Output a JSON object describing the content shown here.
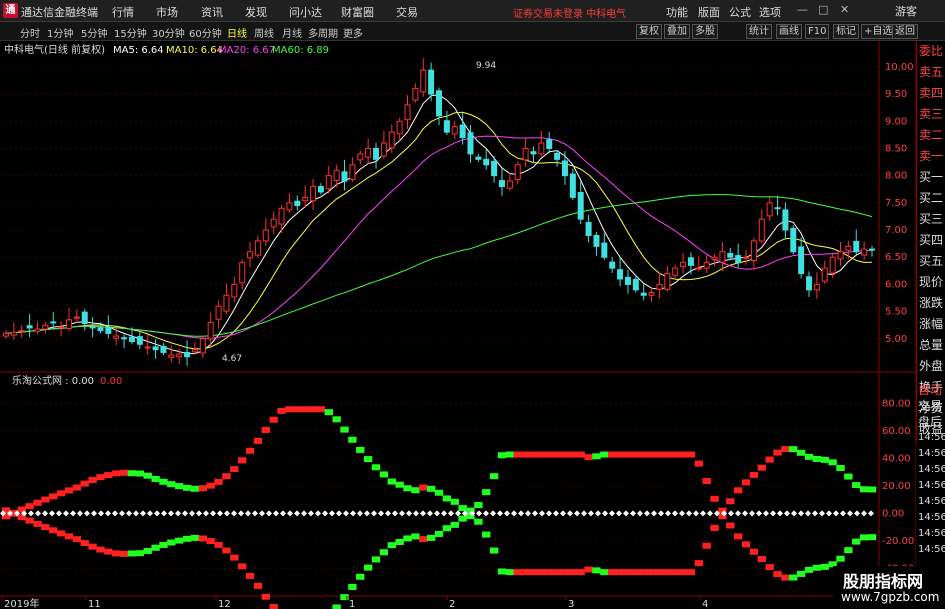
{
  "app": {
    "title": "通达信金融终端",
    "logo_char": "通"
  },
  "menu": [
    "行情",
    "市场",
    "资讯",
    "发现",
    "问小达",
    "财富圈",
    "交易"
  ],
  "login_status": "证券交易未登录  中科电气",
  "tools": [
    "功能",
    "版面",
    "公式",
    "选项"
  ],
  "window_controls": {
    "minimize": "—",
    "maximize": "□",
    "close": "✕",
    "guest": "游客"
  },
  "periods": [
    "分时",
    "1分钟",
    "5分钟",
    "15分钟",
    "30分钟",
    "60分钟",
    "日线",
    "周线",
    "月线",
    "多周期",
    "更多"
  ],
  "active_period": "日线",
  "toolbar_buttons": [
    "复权",
    "叠加",
    "多股",
    "统计",
    "画线",
    "F10",
    "标记",
    "+自选",
    "返回"
  ],
  "stock": {
    "name_line": "中科电气(日线 前复权)",
    "ma": [
      {
        "label": "MA5: 6.64",
        "color": "#ffffff"
      },
      {
        "label": "MA10: 6.64",
        "color": "#ffff40"
      },
      {
        "label": "MA20: 6.67",
        "color": "#ff40ff"
      },
      {
        "label": "MA60: 6.89",
        "color": "#40ff40"
      }
    ],
    "high_label": "9.94",
    "low_label": "4.67"
  },
  "indicator": {
    "name": "乐淘公式网 : 0.00",
    "value": "0.00"
  },
  "price_axis": [
    "10.00",
    "9.50",
    "9.00",
    "8.50",
    "8.00",
    "7.50",
    "7.00",
    "6.50",
    "6.00",
    "5.50",
    "5.00"
  ],
  "indicator_axis": [
    "80.00",
    "60.00",
    "40.00",
    "20.00",
    "0.00",
    "-20.00",
    "-40.00"
  ],
  "date_axis": [
    "2019年",
    "11",
    "12",
    "1",
    "2",
    "3",
    "4"
  ],
  "quote_panel": [
    "委比",
    "卖五",
    "卖四",
    "卖三",
    "卖二",
    "卖一",
    "买一",
    "买二",
    "买三",
    "买四",
    "买五",
    "现价",
    "涨跌",
    "涨幅",
    "总量",
    "外盘",
    "换手",
    "净资",
    "收益"
  ],
  "side_panel": [
    "自动",
    "交易",
    "盘后",
    "14:56",
    "14:56",
    "14:56",
    "14:56",
    "14:56",
    "14:56",
    "14:56",
    "14:56"
  ],
  "colors": {
    "up": "#ff3030",
    "down": "#40e0e0",
    "ma5": "#ffffff",
    "ma10": "#ffff40",
    "ma20": "#ff40ff",
    "ma60": "#40ff40",
    "osc_up": "#ff2020",
    "osc_down": "#20ff20",
    "border": "#8b0000"
  },
  "watermark": {
    "title": "股朋指标网",
    "url": "www.7gpzb.com"
  },
  "chart_data": {
    "type": "candlestick",
    "price_range": [
      4.5,
      10.2
    ],
    "indicator_range": [
      -58,
      92
    ],
    "close_series": [
      5.1,
      5.12,
      5.15,
      5.2,
      5.18,
      5.25,
      5.3,
      5.22,
      5.35,
      5.4,
      5.28,
      5.2,
      5.15,
      5.1,
      5.05,
      5.0,
      4.95,
      4.9,
      4.85,
      4.8,
      4.75,
      4.7,
      4.72,
      4.67,
      4.8,
      5.0,
      5.3,
      5.6,
      5.8,
      6.0,
      6.4,
      6.6,
      6.8,
      7.0,
      7.2,
      7.4,
      7.5,
      7.45,
      7.6,
      7.8,
      7.7,
      8.0,
      8.1,
      7.9,
      8.2,
      8.4,
      8.5,
      8.3,
      8.6,
      8.8,
      9.0,
      9.3,
      9.6,
      9.94,
      9.5,
      9.1,
      8.8,
      8.9,
      8.7,
      8.4,
      8.3,
      8.2,
      8.0,
      7.8,
      7.9,
      8.2,
      8.5,
      8.4,
      8.6,
      8.5,
      8.3,
      8.0,
      7.6,
      7.2,
      6.9,
      6.7,
      6.5,
      6.3,
      6.1,
      6.0,
      5.9,
      5.8,
      5.85,
      6.0,
      6.2,
      6.3,
      6.4,
      6.35,
      6.3,
      6.4,
      6.5,
      6.6,
      6.5,
      6.4,
      6.5,
      6.8,
      7.2,
      7.5,
      7.4,
      7.0,
      6.6,
      6.2,
      5.9,
      6.0,
      6.3,
      6.5,
      6.6,
      6.7,
      6.6,
      6.65,
      6.64
    ]
  }
}
